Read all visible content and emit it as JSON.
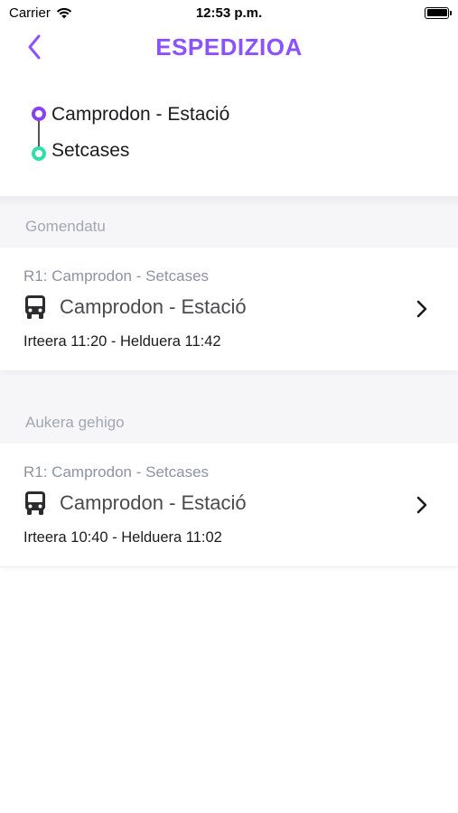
{
  "status_bar": {
    "carrier": "Carrier",
    "time": "12:53 p.m."
  },
  "nav": {
    "title": "ESPEDIZIOA",
    "title_color": "#8c52ff"
  },
  "route": {
    "origin": "Camprodon - Estació",
    "destination": "Setcases",
    "origin_color": "#8a3ff0",
    "destination_color": "#2ee0a8"
  },
  "recommended": {
    "section_title": "Gomendatu",
    "trip": {
      "route_label": "R1: Camprodon - Setcases",
      "stop": "Camprodon - Estació",
      "times": "Irteera 11:20 - Helduera 11:42"
    }
  },
  "more_options": {
    "section_title": "Aukera gehigo",
    "trip": {
      "route_label": "R1: Camprodon - Setcases",
      "stop": "Camprodon - Estació",
      "times": "Irteera 10:40 - Helduera 11:02"
    }
  }
}
